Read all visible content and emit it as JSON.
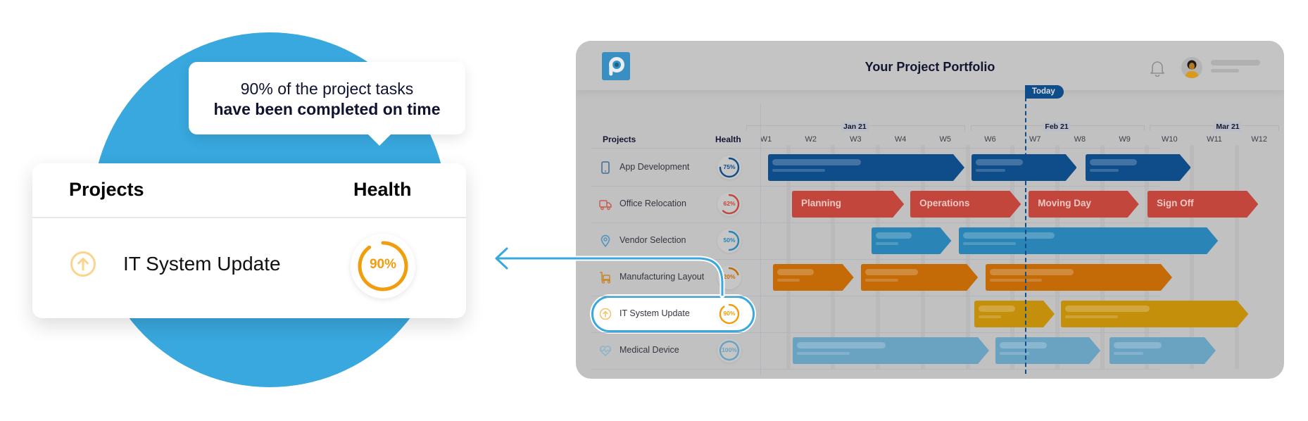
{
  "callout": {
    "tooltip_line1": "90% of the project tasks",
    "tooltip_line2": "have been completed on time",
    "card": {
      "header_projects": "Projects",
      "header_health": "Health",
      "project_name": "IT System Update",
      "project_icon": "arrow-up-circle-icon",
      "health_value": "90%",
      "health_percent": 90,
      "health_color": "#f29d0c"
    },
    "accent_color": "#38a8de"
  },
  "app": {
    "title": "Your Project Portfolio",
    "logo_letter": "p",
    "logo_color": "#3a8fc2",
    "notification_icon": "bell-icon",
    "columns": {
      "projects": "Projects",
      "health": "Health"
    },
    "months": [
      "Jan 21",
      "Feb 21",
      "Mar 21"
    ],
    "weeks": [
      "W1",
      "W2",
      "W3",
      "W4",
      "W5",
      "W6",
      "W7",
      "W8",
      "W9",
      "W10",
      "W11",
      "W12"
    ],
    "today_label": "Today",
    "today_week": 6.79,
    "highlighted_project": "IT System Update",
    "projects": [
      {
        "name": "App Development",
        "icon": "smartphone-icon",
        "health": "75%",
        "health_percent": 75,
        "color": "#0e4c8a",
        "icon_color": "#3d6a96",
        "tasks": [
          {
            "label": "",
            "start": 1.05,
            "end": 5.43
          },
          {
            "label": "",
            "start": 5.58,
            "end": 7.93
          },
          {
            "label": "",
            "start": 8.12,
            "end": 10.47
          }
        ]
      },
      {
        "name": "Office Relocation",
        "icon": "truck-icon",
        "health": "62%",
        "health_percent": 62,
        "color": "#c3463c",
        "icon_color": "#c85a50",
        "tasks": [
          {
            "label": "Planning",
            "start": 1.58,
            "end": 4.08
          },
          {
            "label": "Operations",
            "start": 4.22,
            "end": 6.69
          },
          {
            "label": "Moving Day",
            "start": 6.86,
            "end": 9.32
          },
          {
            "label": "Sign Off",
            "start": 9.51,
            "end": 11.98
          }
        ]
      },
      {
        "name": "Vendor Selection",
        "icon": "map-pin-icon",
        "health": "50%",
        "health_percent": 50,
        "color": "#2a84b5",
        "icon_color": "#4a93c0",
        "tasks": [
          {
            "label": "",
            "start": 3.36,
            "end": 5.14
          },
          {
            "label": "",
            "start": 5.3,
            "end": 11.08
          }
        ]
      },
      {
        "name": "Manufacturing Layout",
        "icon": "cart-icon",
        "health": "20%",
        "health_percent": 20,
        "color": "#c46b07",
        "icon_color": "#c8862a",
        "tasks": [
          {
            "label": "",
            "start": 1.16,
            "end": 2.96
          },
          {
            "label": "",
            "start": 3.12,
            "end": 5.73
          },
          {
            "label": "",
            "start": 5.9,
            "end": 10.06
          }
        ]
      },
      {
        "name": "IT System Update",
        "icon": "arrow-up-circle-icon",
        "health": "90%",
        "health_percent": 90,
        "color": "#c48f0a",
        "icon_color": "#f2c266",
        "tasks": [
          {
            "label": "",
            "start": 5.65,
            "end": 7.44
          },
          {
            "label": "",
            "start": 7.58,
            "end": 11.76
          }
        ]
      },
      {
        "name": "Medical Device",
        "icon": "heart-pulse-icon",
        "health": "100%",
        "health_percent": 100,
        "color": "#6aa2c2",
        "icon_color": "#8cb3c8",
        "tasks": [
          {
            "label": "",
            "start": 1.6,
            "end": 5.98
          },
          {
            "label": "",
            "start": 6.12,
            "end": 8.46
          },
          {
            "label": "",
            "start": 8.66,
            "end": 11.03
          }
        ]
      }
    ]
  }
}
